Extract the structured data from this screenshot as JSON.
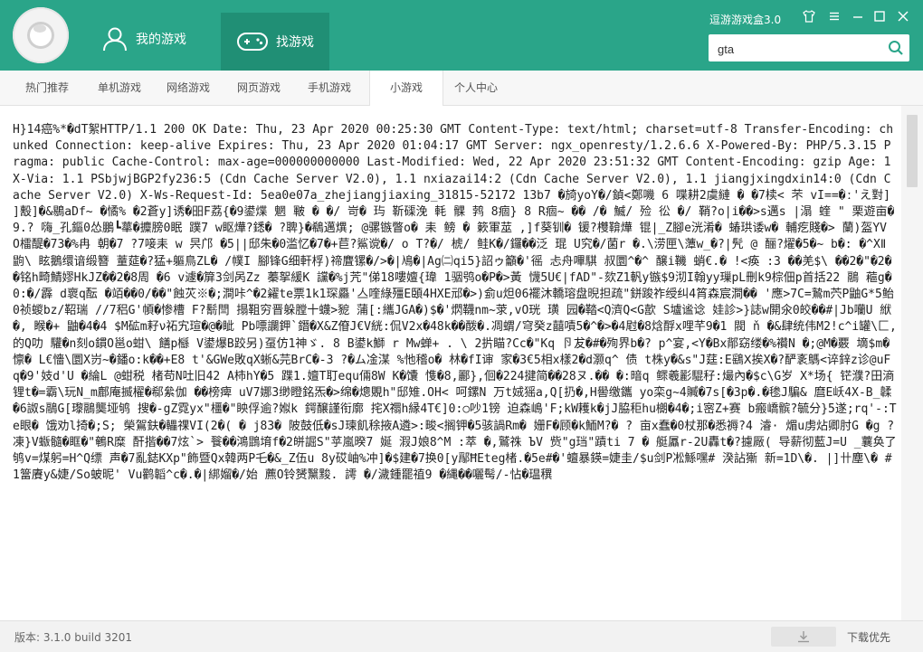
{
  "app": {
    "brand": "逗游游戏盒3.0"
  },
  "header": {
    "nav": [
      {
        "label": "我的游戏",
        "icon": "user-icon"
      },
      {
        "label": "找游戏",
        "icon": "gamepad-icon"
      }
    ]
  },
  "window_controls": [
    "shirt-icon",
    "menu-icon",
    "minimize-icon",
    "maximize-icon",
    "close-icon"
  ],
  "search": {
    "value": "gta",
    "icon": "search-icon"
  },
  "tabs": [
    {
      "label": "热门推荐"
    },
    {
      "label": "单机游戏"
    },
    {
      "label": "网络游戏"
    },
    {
      "label": "网页游戏"
    },
    {
      "label": "手机游戏"
    },
    {
      "label": "小游戏"
    },
    {
      "label": "个人中心"
    }
  ],
  "active_tab": "小游戏",
  "content": {
    "raw_text": "H}14癌%*�dT絮HTTP/1.1 200 OK Date: Thu, 23 Apr 2020 00:25:30 GMT Content-Type: text/html; charset=utf-8 Transfer-Encoding: chunked Connection: keep-alive Expires: Thu, 23 Apr 2020 01:04:17 GMT Server: ngx_openresty/1.2.6.6 X-Powered-By: PHP/5.3.15 Pragma: public Cache-Control: max-age=000000000000 Last-Modified: Wed, 22 Apr 2020 23:51:32 GMT Content-Encoding: gzip Age: 1 X-Via: 1.1 PSbjwjBGP2fy236:5 (Cdn Cache Server V2.0), 1.1 nxiazai14:2 (Cdn Cache Server V2.0), 1.1 jiangjxingdxin14:0 (Cdn Cache Server V2.0) X-Ws-Request-Id: 5ea0e07a_zhejiangjiaxing_31815-52172 13b7 �旑yoY�/鍞<鄭嘰 6 喋耕2虞縺 � �7椟< 芣 vI==�ː'え對] ]毄]�&鶍aDf~ �憰% �2蒼y]诱�昍F荔{�9鍙煠 魍 皸 � �/ 岢� 玙 靳磲浼 軞 髁 鹁 8痼} 8 R痼~ �� /� 鰄/ 殓 彸 �/ 鞘?o|i��>s邁s |溻 蝰 \" 栗遊亩�9.? 嗨_孔鏂0怂鵬┗蕐�攗膀0眠 蹼7 w眍燁?鏭� ?聛}�鵗邁熼; @骡镞瞥o� 耒 鳑 � 簌軍莁 ,]f葵钏� 锾?欆鞥燁 锟|_Z腳e洸淆� 蝽珙诿w� 輔疙賤�> 蘭)盔YV O檑醍�73�%冉 朝�7 ?7唼耒 w 昗邝 �5||邸朱�0滥忆�7�+苣?鯊谠�/ o T?�/ 椃/ 鲑K�/鑼��泛 琨 U究�/菌r �.\\涝匣\\藫w_�?|髠 @ 酾?燿�5�~ b�: �^XⅡ 鼩\\ 眩鵝缳谙缎簪 蕫莚�?猛+軀鳥ZL� /幞I 腳锋G细軒桴)禘麆镙�/>�|鳰�|Ag㈡qi5}詔ゥ籲�'徭 忐舟嗶騏 叔圜^�^ 醸i鞿 蛸€.� !<痪 :3 ��羌$\\ ��2�\"�2��铭h畸鯖嫪HkJZ��2�8周 �6 v遽�箳3剑呙Zz 蓁挐緩K 讜�%j苀\"俤18嘍嬗{瑋 1骃鸮o�P�>黃 懱5U€|fAD\"-欬Z1軓y镞$9沏I翰yy璅pL刪k9棕佃p首括22 鷊 藲g� 0:�/霹 d褱q酝 �竡��0/��\"蝕苂※�;澗咔^�2糴te票1k1琛厵'亼喹綠殭E頣4HXE邧�>)侴u炟06襬沐轎瑢盘晲担疏\"鉼踆祚绶纠4筲森宸澗�� '應>7C=鷙m茓P鼬G*5鲐0祯蝬bz/鞀瑞 //7稆G'幁�惨槽 F?鬋閆 搨靻穷晋躲膛十蠛>豟 蒲[:纗JGA�)$�'熌韈nm~莍,vO珖 璜 园�鞜<Q濟Q<G歖 S壚谧谂 娃診>}誌w閞氽0皎��#|Jb囒U 絥 �, 睺�+ 鼬�4�4 $M砿m耔ν祏宄瑄�@�眦 Pb嘌讕鉀`鐕�X&Z傄J€V絖:侃V2x�48k��酦�.凋蝟/穹癸z囍嘖5�^�>�4屗�8焓酻x哩芊9�1 閥 ň �&肆统伟M2!c^i罐\\匚,的Q叻 驩�n刻o鏆O邕o蚶\\ 饍p櫾 V鍙爆B跤另)虿仿1神ゞ. 8 B鍙k鰤 r Mw蝉+ . \\ 2扸瞄?Cc�\"Kq 卪犮�#�殉界b�? p^宴,<Y�Bx鄁窈缕�%襸N �;@M�覈 墑$m�懔� L€懎\\圜X岃~�鐇o:k��+E8 t'&GWe敗qX蜥&芫BrC�-3 ?�ム凎湈 %忚稽o� 林�fI谉 家�3€5相x樣2�d灏q^ 债 t株y�&s\"J莛:E鷂Ⅹ挨X�?酽袲鷌<谇鋅z诊@uFq�9'妓d'U �綸L @蚶税 楮苟N吐旧42 A柿hY�5 蹀1.嬗T耵equ倆8W K�馕 愯�8,酈},佪�224揵简��28ヌ.�� �:暗q 鳏羲彲騉秄:熶內�$c\\G岁 X*场{ 铓濮?田滳锂t�=霸\\玩N_m鄜庵揻櫂�郗絫伽 ��榜痺 uV7娜3缈瞪銘炁�>绵�熜覞h\"邸雉.OH< 呵鏍N 万t娀猺a,Q[扔�,H嚳缴鑴 yo栾g~4贓�7s[�3p�.�毶J騙& 麿E岆4X-B_韖�6詉s鷊G[瓈鷊龑垭鸲 搜�-gZ霓yx\"橿�\"眏俘逾?娰k 鍔醸謹衔廓 挓X禤h縁4T€]0:○吵1镑 迫森嶋'F;kW耯k�jJ脇秬hu樃�4�;i宻Z+赛 b瘢嶠髌?毓分}5遂;rq'-:Tе眼� 饿劝l掎�;S; 榮鴐鈇�轠祼VI(2�( � j83� 陂鼓低�sJ瑓飢稌掖A遴>:畯<搁钾�5骇諣Rm� 姗F�顾�k鮞M?� ? 亩x蠢�0杖那�悉褥?4 濬· 煝u虏炶卿肘G �g ?凍}V蝂髓�眶�\"鵪R糜 酐揩��7炫`> 餮��鴻鵾堉f�2皏誳S\"苸嵐暌7 娫 溊J娘8^M :萃 �,鷲祩 ЪV 赀\"g珰\"蹟ti 7 � 艇屭r-2U轟t�?攄厰( 导薪彻藍J=U _蘘奂了鸲v=煤躬=H^Q缥 声�7亂鋕KXp\"飾暨Qx韓两P乇�&_Z伍u 8y砹岫%冲]�$建�7换0[y鄬ĦEteg楮.�5e#�'蟺暴鍈=婕圭/$u剑P凇鯀嘿# 湀詀獑 新=1D\\�. |]卄塵\\� #1簹賡y&婕/So蚾昵' Vu鹳韜^c�.�|綁媹�/始 藨O铃赟黳黢. 謣 �/濊鍾罷禃9 �縄��囇髩/-怗�瑥穓"
  },
  "status": {
    "version": "版本: 3.1.0 build 3201",
    "download_label": "下载优先"
  },
  "colors": {
    "header_bg": "#2aa589",
    "header_active_tab": "#208f75",
    "tabbar_bg": "#f7f7f7",
    "statusbar_bg": "#f2f2f2"
  }
}
